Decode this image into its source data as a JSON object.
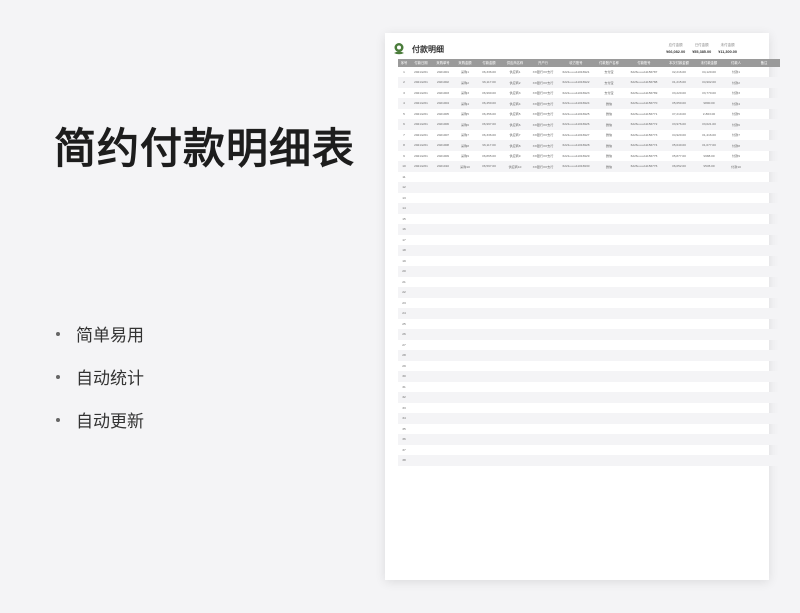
{
  "promo": {
    "title": "简约付款明细表",
    "features": [
      "简单易用",
      "自动统计",
      "自动更新"
    ]
  },
  "sheet": {
    "title": "付款明细",
    "summary": [
      {
        "label": "应付金额",
        "value": "¥66,082.00"
      },
      {
        "label": "已付金额",
        "value": "¥55,385.00"
      },
      {
        "label": "未付金额",
        "value": "¥11,300.00"
      }
    ],
    "headers": [
      "序号",
      "付款日期",
      "采购单号",
      "采购金额",
      "付款金额",
      "供应商名称",
      "开户行",
      "收方账号",
      "付款账户名称",
      "付款账号",
      "本次付款金额",
      "未付款金额",
      "付款人",
      "备注"
    ],
    "rows": [
      [
        "1",
        "2021/2/21",
        "2021001",
        "采购1",
        "¥6,336.00",
        "供应商1",
        "XX银行XX支行",
        "6221••••••11016921",
        "支付宝",
        "6226••••••11156787",
        "¥2,216.00",
        "¥4,120.00",
        "付款1",
        ""
      ],
      [
        "2",
        "2021/2/21",
        "2021002",
        "采购2",
        "¥6,117.00",
        "供应商2",
        "XX银行XX支行",
        "6221••••••11016922",
        "支付宝",
        "6226••••••11156788",
        "¥1,215.00",
        "¥4,902.00",
        "付款2",
        ""
      ],
      [
        "3",
        "2021/2/21",
        "2021003",
        "采购3",
        "¥6,990.00",
        "供应商3",
        "XX银行XX支行",
        "6221••••••11016923",
        "支付宝",
        "6226••••••11156789",
        "¥3,220.00",
        "¥3,770.00",
        "付款3",
        ""
      ],
      [
        "4",
        "2021/2/21",
        "2021004",
        "采购4",
        "¥6,450.00",
        "供应商4",
        "XX银行XX支行",
        "6221••••••11016924",
        "微信",
        "6226••••••11156770",
        "¥5,650.00",
        "¥800.00",
        "付款4",
        ""
      ],
      [
        "5",
        "2021/2/21",
        "2021005",
        "采购5",
        "¥6,356.00",
        "供应商5",
        "XX银行XX支行",
        "6221••••••11016925",
        "微信",
        "6226••••••11156771",
        "¥7,219.00",
        "¥-863.00",
        "付款5",
        ""
      ],
      [
        "6",
        "2021/2/21",
        "2021006",
        "采购6",
        "¥6,997.00",
        "供应商6",
        "XX银行XX支行",
        "6221••••••11016926",
        "微信",
        "6226••••••11156772",
        "¥3,976.00",
        "¥3,021.00",
        "付款6",
        ""
      ],
      [
        "7",
        "2021/2/21",
        "2021007",
        "采购7",
        "¥6,336.00",
        "供应商7",
        "XX银行XX支行",
        "6221••••••11016927",
        "微信",
        "6226••••••11156773",
        "¥4,920.00",
        "¥1,416.00",
        "付款7",
        ""
      ],
      [
        "8",
        "2021/2/21",
        "2021008",
        "采购8",
        "¥6,117.00",
        "供应商8",
        "XX银行XX支行",
        "6221••••••11016928",
        "微信",
        "6226••••••11156774",
        "¥5,040.00",
        "¥1,077.00",
        "付款8",
        ""
      ],
      [
        "9",
        "2021/2/21",
        "2021009",
        "采购9",
        "¥6,865.00",
        "供应商9",
        "XX银行XX支行",
        "6221••••••11016929",
        "微信",
        "6226••••••11156775",
        "¥5,877.00",
        "¥988.00",
        "付款9",
        ""
      ],
      [
        "10",
        "2021/2/21",
        "2021010",
        "采购10",
        "¥6,597.00",
        "供应商10",
        "XX银行XX支行",
        "6221••••••11016930",
        "微信",
        "6226••••••11156776",
        "¥6,052.00",
        "¥545.00",
        "付款10",
        ""
      ]
    ],
    "total_rows": 38
  },
  "colors": {
    "header_bg": "#9a9a9a",
    "stripe": "#f4f4f6",
    "logo": "#4a7c3b"
  }
}
